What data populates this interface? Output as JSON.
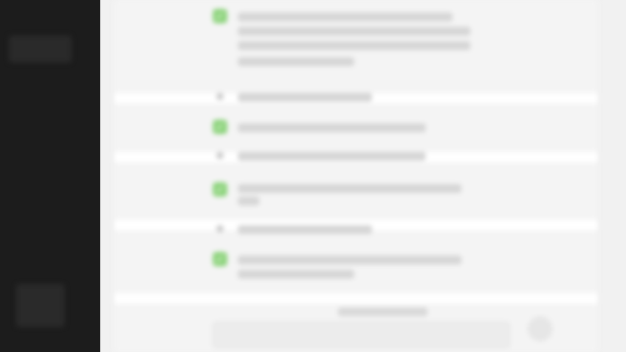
{
  "colors": {
    "sidebar": "#1c1c1c",
    "background": "#f3f3f3",
    "check": "#8bd37a",
    "separator": "#ffffff"
  },
  "checklist": [
    {
      "state": "checked",
      "icon": "check-icon"
    },
    {
      "state": "unchecked",
      "icon": "dot-icon"
    },
    {
      "state": "checked",
      "icon": "check-icon"
    },
    {
      "state": "unchecked",
      "icon": "dot-icon"
    },
    {
      "state": "checked",
      "icon": "check-icon"
    },
    {
      "state": "unchecked",
      "icon": "dot-icon"
    },
    {
      "state": "checked",
      "icon": "check-icon"
    }
  ]
}
